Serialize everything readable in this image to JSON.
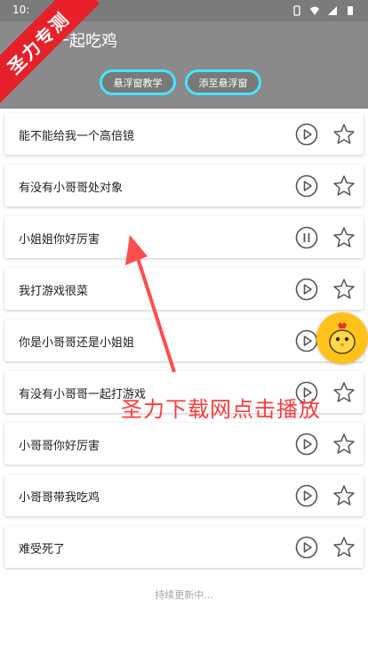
{
  "status_bar": {
    "time": "10:"
  },
  "app_bar": {
    "title": "一起吃鸡",
    "buttons": [
      {
        "label": "悬浮窗教学"
      },
      {
        "label": "添至悬浮窗"
      }
    ]
  },
  "badge": {
    "text": "圣力专测"
  },
  "list": {
    "items": [
      {
        "text": "能不能给我一个高倍镜",
        "state": "play"
      },
      {
        "text": "有没有小哥哥处对象",
        "state": "play"
      },
      {
        "text": "小姐姐你好厉害",
        "state": "pause"
      },
      {
        "text": "我打游戏很菜",
        "state": "play"
      },
      {
        "text": "你是小哥哥还是小姐姐",
        "state": "play"
      },
      {
        "text": "有没有小哥哥一起打游戏",
        "state": "play"
      },
      {
        "text": "小哥哥你好厉害",
        "state": "play"
      },
      {
        "text": "小哥哥带我吃鸡",
        "state": "play"
      },
      {
        "text": "难受死了",
        "state": "play"
      }
    ]
  },
  "footer": {
    "text": "持续更新中..."
  },
  "overlay": {
    "text": "圣力下载网点击播放"
  },
  "colors": {
    "pill_border": "#44e6ff",
    "badge": "#e72029",
    "arrow": "#ff4d4d",
    "mascot": "#ffc21a"
  }
}
